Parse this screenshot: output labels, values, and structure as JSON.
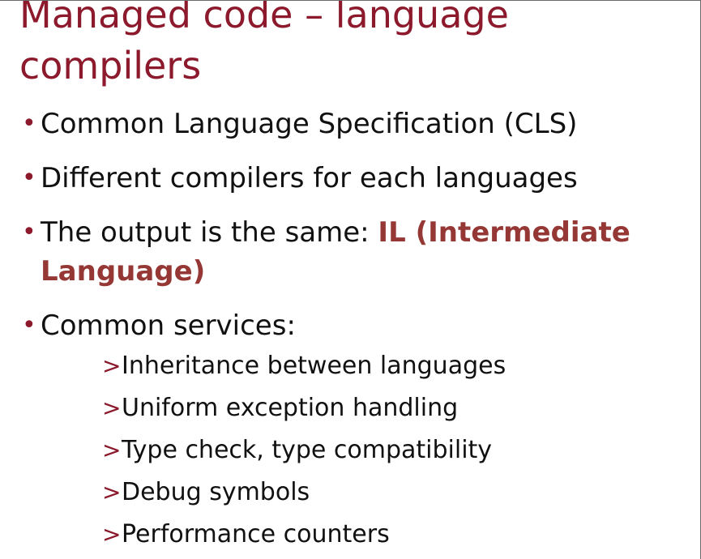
{
  "slide": {
    "title": "Managed code – language compilers",
    "bullets": [
      {
        "text": "Common Language Specification (CLS)"
      },
      {
        "text": "Different compilers for each languages"
      },
      {
        "text": "The output is the same: ",
        "highlight": "IL (Intermediate Language)"
      },
      {
        "text": "Common services:"
      }
    ],
    "sub_bullets": [
      "Inheritance between languages",
      "Uniform exception handling",
      "Type check, type compatibility",
      "Debug symbols",
      "Performance counters"
    ],
    "bullet_glyph": "•",
    "sub_bullet_glyph": ">",
    "colors": {
      "title": "#8c1a2c",
      "highlight": "#953734",
      "text": "#111111"
    }
  }
}
